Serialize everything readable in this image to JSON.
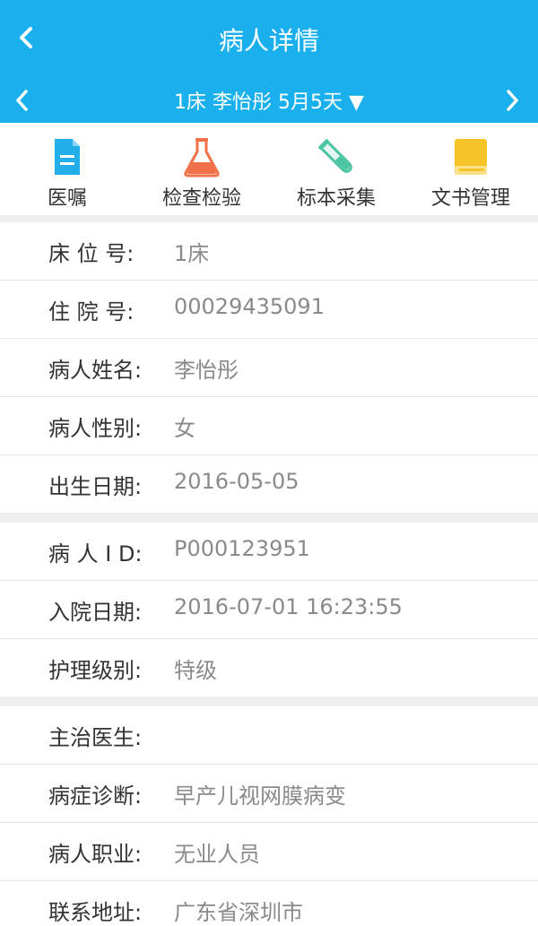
{
  "header": {
    "title": "病人详情",
    "patient_summary": "1床 李怡彤 5月5天 ▼"
  },
  "toolbar": [
    {
      "label": "医嘱",
      "icon": "document-icon",
      "color": "#22aee8"
    },
    {
      "label": "检查检验",
      "icon": "flask-icon",
      "color": "#f07148"
    },
    {
      "label": "标本采集",
      "icon": "test-tube-icon",
      "color": "#4cc6a2"
    },
    {
      "label": "文书管理",
      "icon": "book-icon",
      "color": "#f6c426"
    }
  ],
  "sections": [
    {
      "rows": [
        {
          "label": "床 位 号:",
          "value": "1床"
        },
        {
          "label": "住 院 号:",
          "value": "00029435091"
        },
        {
          "label": "病人姓名:",
          "value": "李怡彤"
        },
        {
          "label": "病人性别:",
          "value": "女"
        },
        {
          "label": "出生日期:",
          "value": "2016-05-05"
        }
      ]
    },
    {
      "rows": [
        {
          "label": "病 人 I D:",
          "value": "P000123951"
        },
        {
          "label": "入院日期:",
          "value": "2016-07-01 16:23:55"
        },
        {
          "label": "护理级别:",
          "value": "特级"
        }
      ]
    },
    {
      "rows": [
        {
          "label": "主治医生:",
          "value": ""
        },
        {
          "label": "病症诊断:",
          "value": "早产儿视网膜病变"
        },
        {
          "label": "病人职业:",
          "value": "无业人员"
        },
        {
          "label": "联系地址:",
          "value": "广东省深圳市"
        }
      ]
    }
  ],
  "colors": {
    "header_bg": "#1ab0ee",
    "separator": "#efefef",
    "label_text": "#333333",
    "value_text": "#8a8a8a"
  }
}
